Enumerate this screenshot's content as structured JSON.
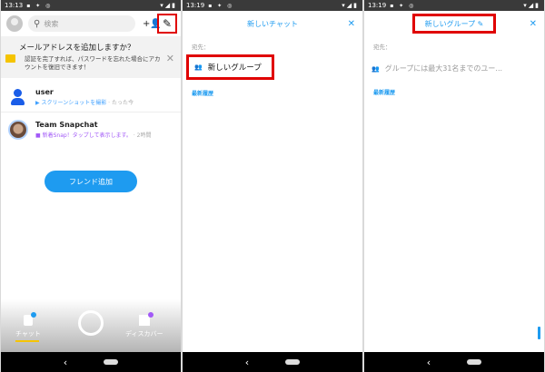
{
  "status": {
    "time": "13:13",
    "time2": "13:19",
    "time3": "13:19"
  },
  "panel1": {
    "search_placeholder": "検索",
    "banner": {
      "title": "メールアドレスを追加しますか？",
      "body": "認証を完了すれば、パスワードを忘れた場合にアカウントを復旧できます！"
    },
    "chats": [
      {
        "name": "user",
        "sub_action": "スクリーンショットを撮影",
        "sub_time": "たった今"
      },
      {
        "name": "Team Snapchat",
        "sub_action": "新着Snap！タップして表示します。",
        "sub_time": "2時間"
      }
    ],
    "add_friend_label": "フレンド追加",
    "tabs": {
      "chat": "チャット",
      "discover": "ディスカバー"
    }
  },
  "panel2": {
    "title": "新しいチャット",
    "to_label": "宛先：",
    "new_group_label": "新しいグループ",
    "recent_label": "最新履歴"
  },
  "panel3": {
    "title": "新しいグループ",
    "to_label": "宛先：",
    "hint": "グループには最大31名までのユー...",
    "recent_label": "最新履歴"
  },
  "colors": {
    "accent": "#1e9bf0",
    "highlight": "#e00000",
    "snap_yellow": "#f5c400",
    "purple": "#a259f7"
  },
  "icons": [
    "search-icon",
    "add-friend-icon",
    "new-chat-icon",
    "close-icon",
    "group-icon",
    "pencil-icon",
    "back-icon",
    "home-icon"
  ]
}
